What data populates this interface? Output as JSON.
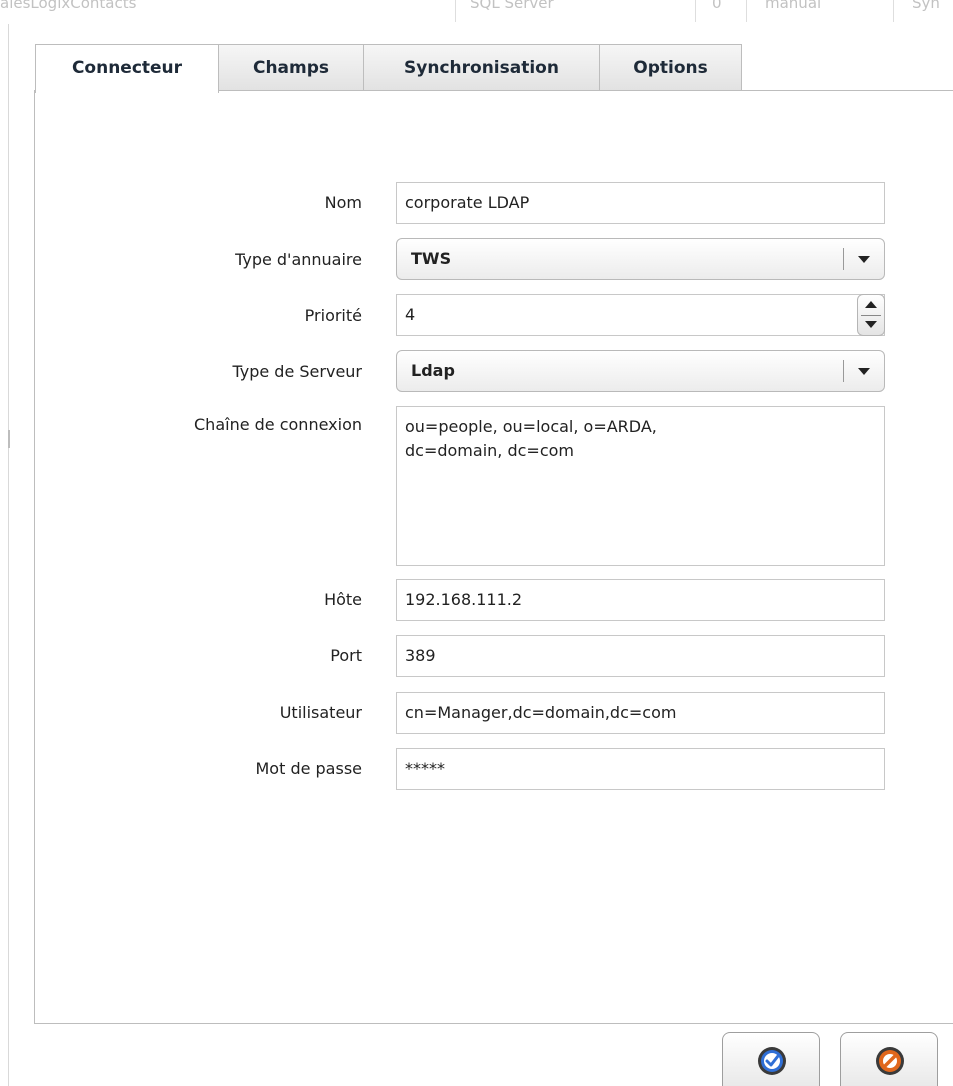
{
  "background_header": {
    "col1": "alesLogixContacts",
    "col2": "SQL Server",
    "col3": "0",
    "col4": "manual",
    "col5": "Syn"
  },
  "tabs": [
    {
      "label": "Connecteur",
      "active": true
    },
    {
      "label": "Champs",
      "active": false
    },
    {
      "label": "Synchronisation",
      "active": false
    },
    {
      "label": "Options",
      "active": false
    }
  ],
  "form": {
    "name": {
      "label": "Nom",
      "value": "corporate LDAP"
    },
    "directory_type": {
      "label": "Type d'annuaire",
      "value": "TWS"
    },
    "priority": {
      "label": "Priorité",
      "value": "4"
    },
    "server_type": {
      "label": "Type de Serveur",
      "value": "Ldap"
    },
    "connection_string": {
      "label": "Chaîne de connexion",
      "value": "ou=people, ou=local, o=ARDA,\ndc=domain, dc=com"
    },
    "host": {
      "label": "Hôte",
      "value": "192.168.111.2"
    },
    "port": {
      "label": "Port",
      "value": "389"
    },
    "user": {
      "label": "Utilisateur",
      "value": "cn=Manager,dc=domain,dc=com"
    },
    "password": {
      "label": "Mot de passe",
      "value": "*****"
    }
  },
  "buttons": {
    "ok_icon": "check-circle-icon",
    "cancel_icon": "no-entry-icon",
    "ok_color": "#2f6fd6",
    "cancel_color": "#e0671c"
  }
}
